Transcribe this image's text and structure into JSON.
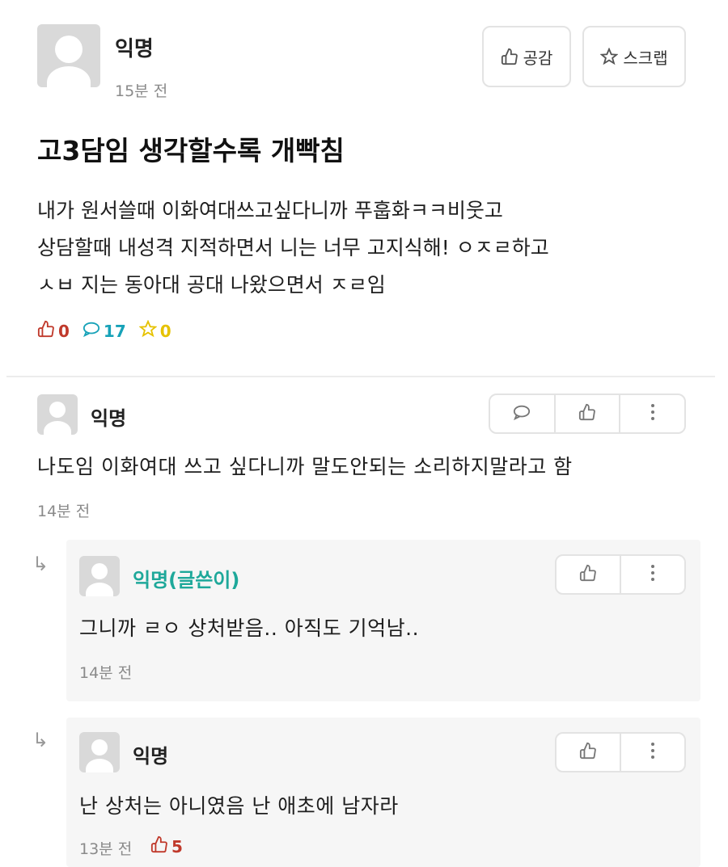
{
  "post": {
    "author": "익명",
    "time": "15분 전",
    "buttons": {
      "like_label": "공감",
      "scrap_label": "스크랩"
    },
    "title": "고3담임 생각할수록 개빡침",
    "body_lines": [
      "내가 원서쓸때 이화여대쓰고싶다니까 푸훕화ㅋㅋ비웃고",
      "상담할때 내성격 지적하면서 니는 너무 고지식해! ㅇㅈㄹ하고",
      "ㅅㅂ 지는 동아대 공대 나왔으면서 ㅈㄹ임"
    ],
    "stats": {
      "likes": "0",
      "comments": "17",
      "scraps": "0"
    },
    "colors": {
      "like": "#c0392b",
      "comment": "#17a2b8",
      "scrap": "#e6c200"
    }
  },
  "comments": [
    {
      "author": "익명",
      "text": "나도임 이화여대 쓰고 싶다니까 말도안되는 소리하지말라고 함",
      "time": "14분 전",
      "icons": [
        "comment-icon",
        "thumbs-up-icon",
        "more-icon"
      ]
    },
    {
      "author": "익명(글쓴이)",
      "author_color": "#1ea89a",
      "text": "그니까 ㄹㅇ 상처받음.. 아직도 기억남..",
      "time": "14분 전",
      "icons": [
        "thumbs-up-icon",
        "more-icon"
      ]
    },
    {
      "author": "익명",
      "text": "난 상처는 아니였음 난 애초에 남자라",
      "time": "13분 전",
      "likes": "5",
      "icons": [
        "thumbs-up-icon",
        "more-icon"
      ]
    }
  ]
}
